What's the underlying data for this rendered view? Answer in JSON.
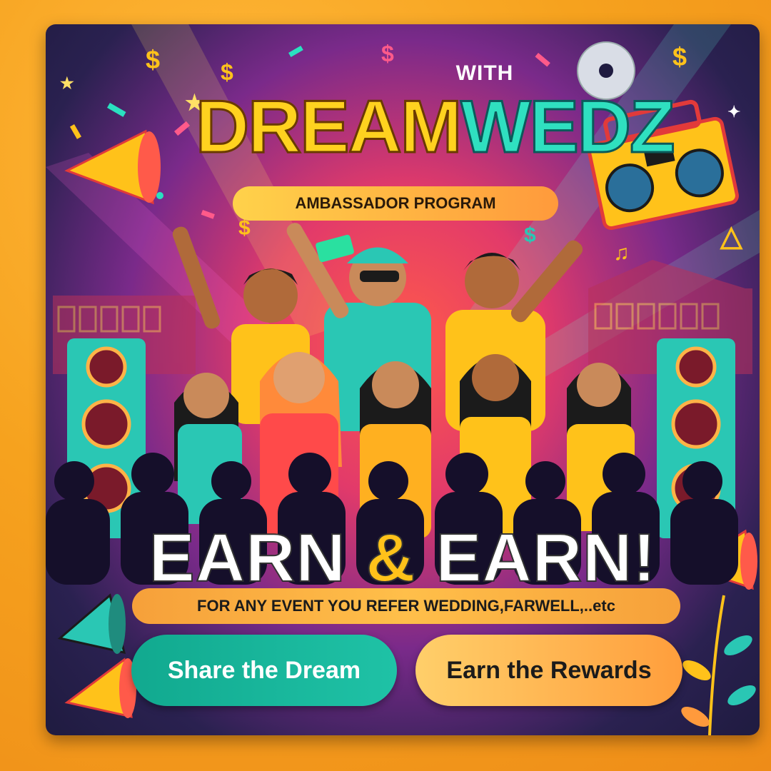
{
  "poster": {
    "prefix": "WITH",
    "brand_part1": "DREAM",
    "brand_part2": "WEDZ",
    "program_label": "AMBASSADOR PROGRAM",
    "headline_left": "EARN",
    "headline_amp": "&",
    "headline_right": "EARN!",
    "refer_text": "FOR ANY EVENT YOU REFER  WEDDING,FARWELL,..etc",
    "share_button": "Share the Dream",
    "rewards_button": "Earn the Rewards"
  },
  "colors": {
    "background": "#f6a21e",
    "brand_yellow": "#ffd21f",
    "brand_teal": "#2fe0c0",
    "share_button": "#1fc2a6",
    "rewards_button": "#ffb04a"
  }
}
